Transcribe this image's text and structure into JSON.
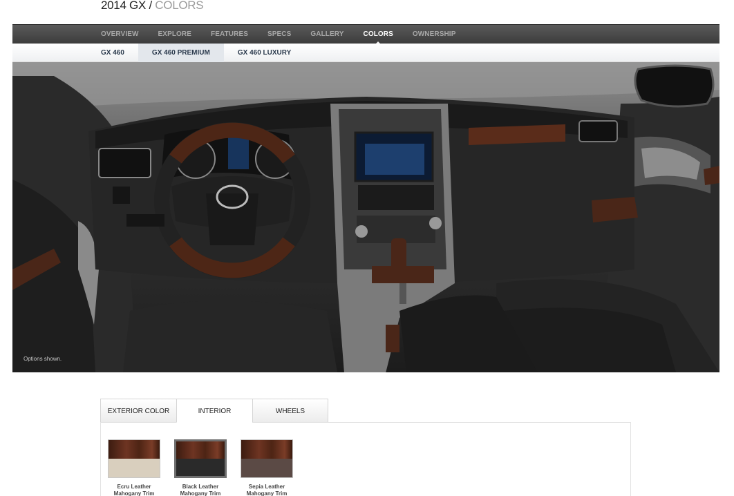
{
  "header": {
    "model": "2014 GX",
    "separator": " / ",
    "section": "COLORS"
  },
  "main_nav": [
    {
      "label": "OVERVIEW",
      "active": false
    },
    {
      "label": "EXPLORE",
      "active": false
    },
    {
      "label": "FEATURES",
      "active": false
    },
    {
      "label": "SPECS",
      "active": false
    },
    {
      "label": "GALLERY",
      "active": false
    },
    {
      "label": "COLORS",
      "active": true
    },
    {
      "label": "OWNERSHIP",
      "active": false
    }
  ],
  "sub_nav": [
    {
      "label": "GX 460",
      "active": false
    },
    {
      "label": "GX 460 PREMIUM",
      "active": true
    },
    {
      "label": "GX 460 LUXURY",
      "active": false
    }
  ],
  "hero": {
    "note": "Options shown."
  },
  "tabs": [
    {
      "label": "EXTERIOR COLOR",
      "active": false
    },
    {
      "label": "INTERIOR",
      "active": true
    },
    {
      "label": "WHEELS",
      "active": false
    }
  ],
  "swatches": [
    {
      "line1": "Ecru Leather",
      "line2": "Mahogany Trim",
      "leather_color": "#d9cfbe",
      "selected": false
    },
    {
      "line1": "Black Leather",
      "line2": "Mahogany Trim",
      "leather_color": "#2a2a2a",
      "selected": true
    },
    {
      "line1": "Sepia Leather",
      "line2": "Mahogany Trim",
      "leather_color": "#5b4a45",
      "selected": false
    }
  ]
}
